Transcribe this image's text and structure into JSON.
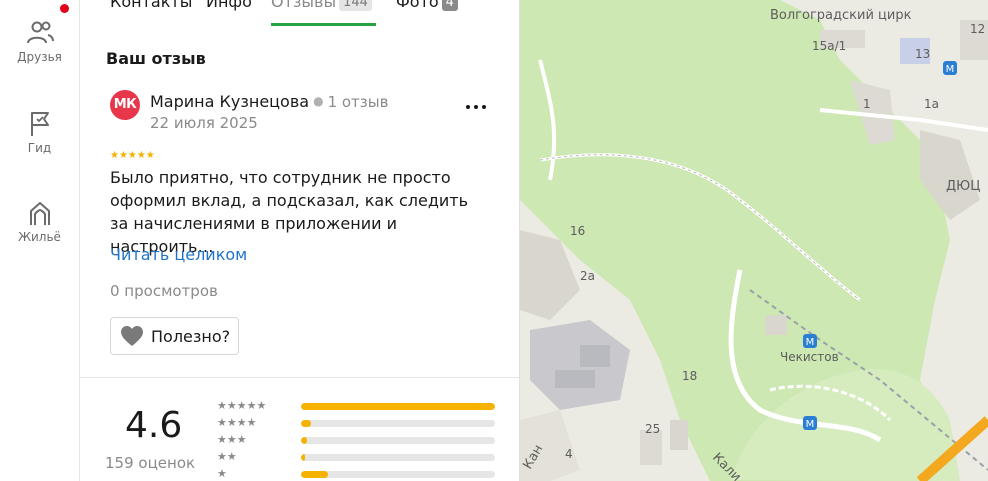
{
  "rail": {
    "items": [
      {
        "label": "Друзья",
        "icon": "friends-icon"
      },
      {
        "label": "Гид",
        "icon": "flag-icon"
      },
      {
        "label": "Жильё",
        "icon": "housing-icon"
      }
    ],
    "notification": true
  },
  "tabs": [
    {
      "label": "Контакты"
    },
    {
      "label": "Инфо"
    },
    {
      "label": "Отзывы",
      "count": "144",
      "active": true
    },
    {
      "label": "Фото",
      "count": "4"
    }
  ],
  "review": {
    "section_title": "Ваш отзыв",
    "avatar_initials": "МК",
    "author": "Марина Кузнецова",
    "author_reviews": "1 отзыв",
    "date": "22 июля 2025",
    "stars": "★★★★★",
    "text": "Было приятно, что сотрудник не просто оформил вклад, а подсказал, как следить за начислениями в приложении и настроить…",
    "read_more": "Читать целиком",
    "views": "0 просмотров",
    "helpful_label": "Полезно?"
  },
  "summary": {
    "rating": "4.6",
    "ratings_count": "159 оценок",
    "distribution": [
      {
        "stars": "★★★★★",
        "fraction": 1.0
      },
      {
        "stars": "★★★★",
        "fraction": 0.05
      },
      {
        "stars": "★★★",
        "fraction": 0.03
      },
      {
        "stars": "★★",
        "fraction": 0.01
      },
      {
        "stars": "★",
        "fraction": 0.14
      }
    ]
  },
  "map": {
    "labels": [
      "Волгоградский цирк",
      "15а/1",
      "13",
      "12",
      "1",
      "1а",
      "ДЮЦ",
      "16",
      "2а",
      "Чекистов",
      "18",
      "25",
      "4",
      "Кали",
      "Кан"
    ]
  },
  "colors": {
    "accent_green": "#29a341",
    "link_blue": "#1f73c9",
    "star_yellow": "#f5b300",
    "avatar_red": "#e8374b",
    "notification_red": "#e2001a",
    "park_green": "#cde8b2"
  }
}
